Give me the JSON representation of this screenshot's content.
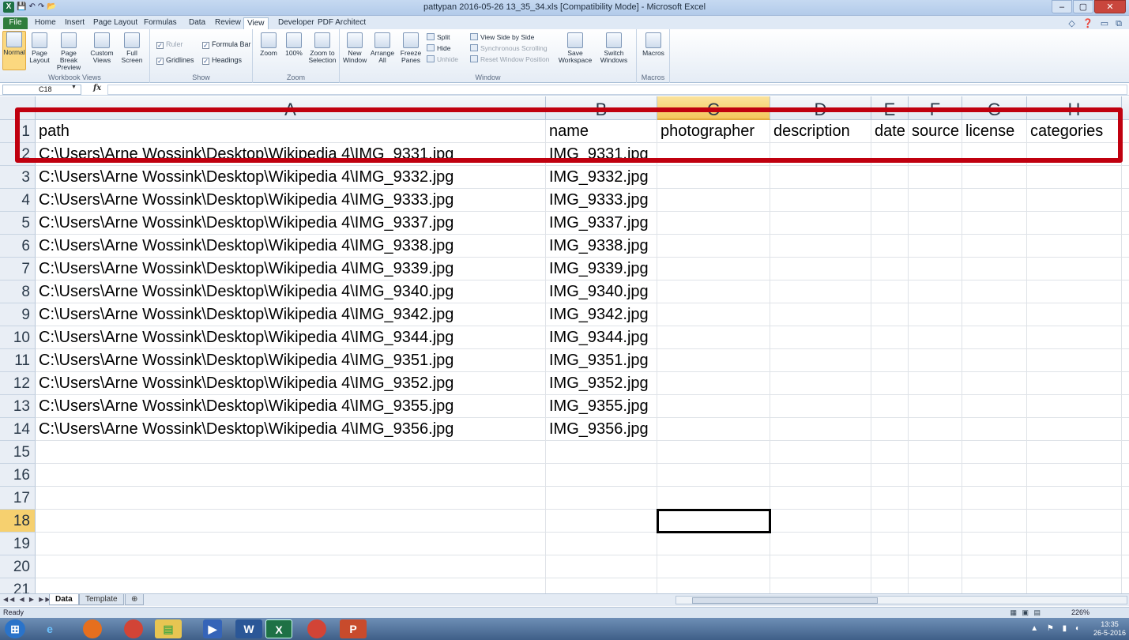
{
  "window": {
    "title": "pattypan 2016-05-26 13_35_34.xls  [Compatibility Mode]  -  Microsoft Excel",
    "min": "–",
    "max": "▢",
    "close": "✕"
  },
  "ribbon_tabs": [
    "File",
    "Home",
    "Insert",
    "Page Layout",
    "Formulas",
    "Data",
    "Review",
    "View",
    "Developer",
    "PDF Architect"
  ],
  "active_tab": "View",
  "ribbon": {
    "workbook_views": {
      "label": "Workbook Views",
      "normal": "Normal",
      "page_layout": "Page Layout",
      "page_break": "Page Break Preview",
      "custom": "Custom Views",
      "full": "Full Screen"
    },
    "show": {
      "label": "Show",
      "ruler": "Ruler",
      "formula_bar": "Formula Bar",
      "gridlines": "Gridlines",
      "headings": "Headings"
    },
    "zoom": {
      "label": "Zoom",
      "zoom": "Zoom",
      "hundred": "100%",
      "to_selection": "Zoom to Selection"
    },
    "window": {
      "label": "Window",
      "new_window": "New Window",
      "arrange_all": "Arrange All",
      "freeze": "Freeze Panes",
      "split": "Split",
      "hide": "Hide",
      "unhide": "Unhide",
      "side_by_side": "View Side by Side",
      "sync_scroll": "Synchronous Scrolling",
      "reset_pos": "Reset Window Position",
      "save_ws": "Save Workspace",
      "switch": "Switch Windows"
    },
    "macros": {
      "label": "Macros",
      "macros": "Macros"
    }
  },
  "formula_bar": {
    "name_box": "C18",
    "fx": "fx",
    "value": ""
  },
  "columns": [
    "A",
    "B",
    "C",
    "D",
    "E",
    "F",
    "G",
    "H"
  ],
  "selected_column": "C",
  "rows": [
    {
      "n": "1",
      "a": "path",
      "b": "name",
      "c": "photographer",
      "d": "description",
      "e": "date",
      "f": "source",
      "g": "license",
      "h": "categories"
    },
    {
      "n": "2",
      "a": "C:\\Users\\Arne Wossink\\Desktop\\Wikipedia 4\\IMG_9331.jpg",
      "b": "IMG_9331.jpg"
    },
    {
      "n": "3",
      "a": "C:\\Users\\Arne Wossink\\Desktop\\Wikipedia 4\\IMG_9332.jpg",
      "b": "IMG_9332.jpg"
    },
    {
      "n": "4",
      "a": "C:\\Users\\Arne Wossink\\Desktop\\Wikipedia 4\\IMG_9333.jpg",
      "b": "IMG_9333.jpg"
    },
    {
      "n": "5",
      "a": "C:\\Users\\Arne Wossink\\Desktop\\Wikipedia 4\\IMG_9337.jpg",
      "b": "IMG_9337.jpg"
    },
    {
      "n": "6",
      "a": "C:\\Users\\Arne Wossink\\Desktop\\Wikipedia 4\\IMG_9338.jpg",
      "b": "IMG_9338.jpg"
    },
    {
      "n": "7",
      "a": "C:\\Users\\Arne Wossink\\Desktop\\Wikipedia 4\\IMG_9339.jpg",
      "b": "IMG_9339.jpg"
    },
    {
      "n": "8",
      "a": "C:\\Users\\Arne Wossink\\Desktop\\Wikipedia 4\\IMG_9340.jpg",
      "b": "IMG_9340.jpg"
    },
    {
      "n": "9",
      "a": "C:\\Users\\Arne Wossink\\Desktop\\Wikipedia 4\\IMG_9342.jpg",
      "b": "IMG_9342.jpg"
    },
    {
      "n": "10",
      "a": "C:\\Users\\Arne Wossink\\Desktop\\Wikipedia 4\\IMG_9344.jpg",
      "b": "IMG_9344.jpg"
    },
    {
      "n": "11",
      "a": "C:\\Users\\Arne Wossink\\Desktop\\Wikipedia 4\\IMG_9351.jpg",
      "b": "IMG_9351.jpg"
    },
    {
      "n": "12",
      "a": "C:\\Users\\Arne Wossink\\Desktop\\Wikipedia 4\\IMG_9352.jpg",
      "b": "IMG_9352.jpg"
    },
    {
      "n": "13",
      "a": "C:\\Users\\Arne Wossink\\Desktop\\Wikipedia 4\\IMG_9355.jpg",
      "b": "IMG_9355.jpg"
    },
    {
      "n": "14",
      "a": "C:\\Users\\Arne Wossink\\Desktop\\Wikipedia 4\\IMG_9356.jpg",
      "b": "IMG_9356.jpg"
    },
    {
      "n": "15"
    },
    {
      "n": "16"
    },
    {
      "n": "17"
    },
    {
      "n": "18"
    },
    {
      "n": "19"
    },
    {
      "n": "20"
    },
    {
      "n": "21"
    }
  ],
  "selected_row": "18",
  "sheet_tabs": [
    "Data",
    "Template"
  ],
  "active_sheet": "Data",
  "status": {
    "ready": "Ready",
    "zoom": "226%"
  },
  "taskbar": {
    "time": "13:35",
    "date": "26-5-2016"
  },
  "colors": {
    "highlight": "#c0000f",
    "excel_green": "#1e7145",
    "selection": "#f6d06f"
  }
}
